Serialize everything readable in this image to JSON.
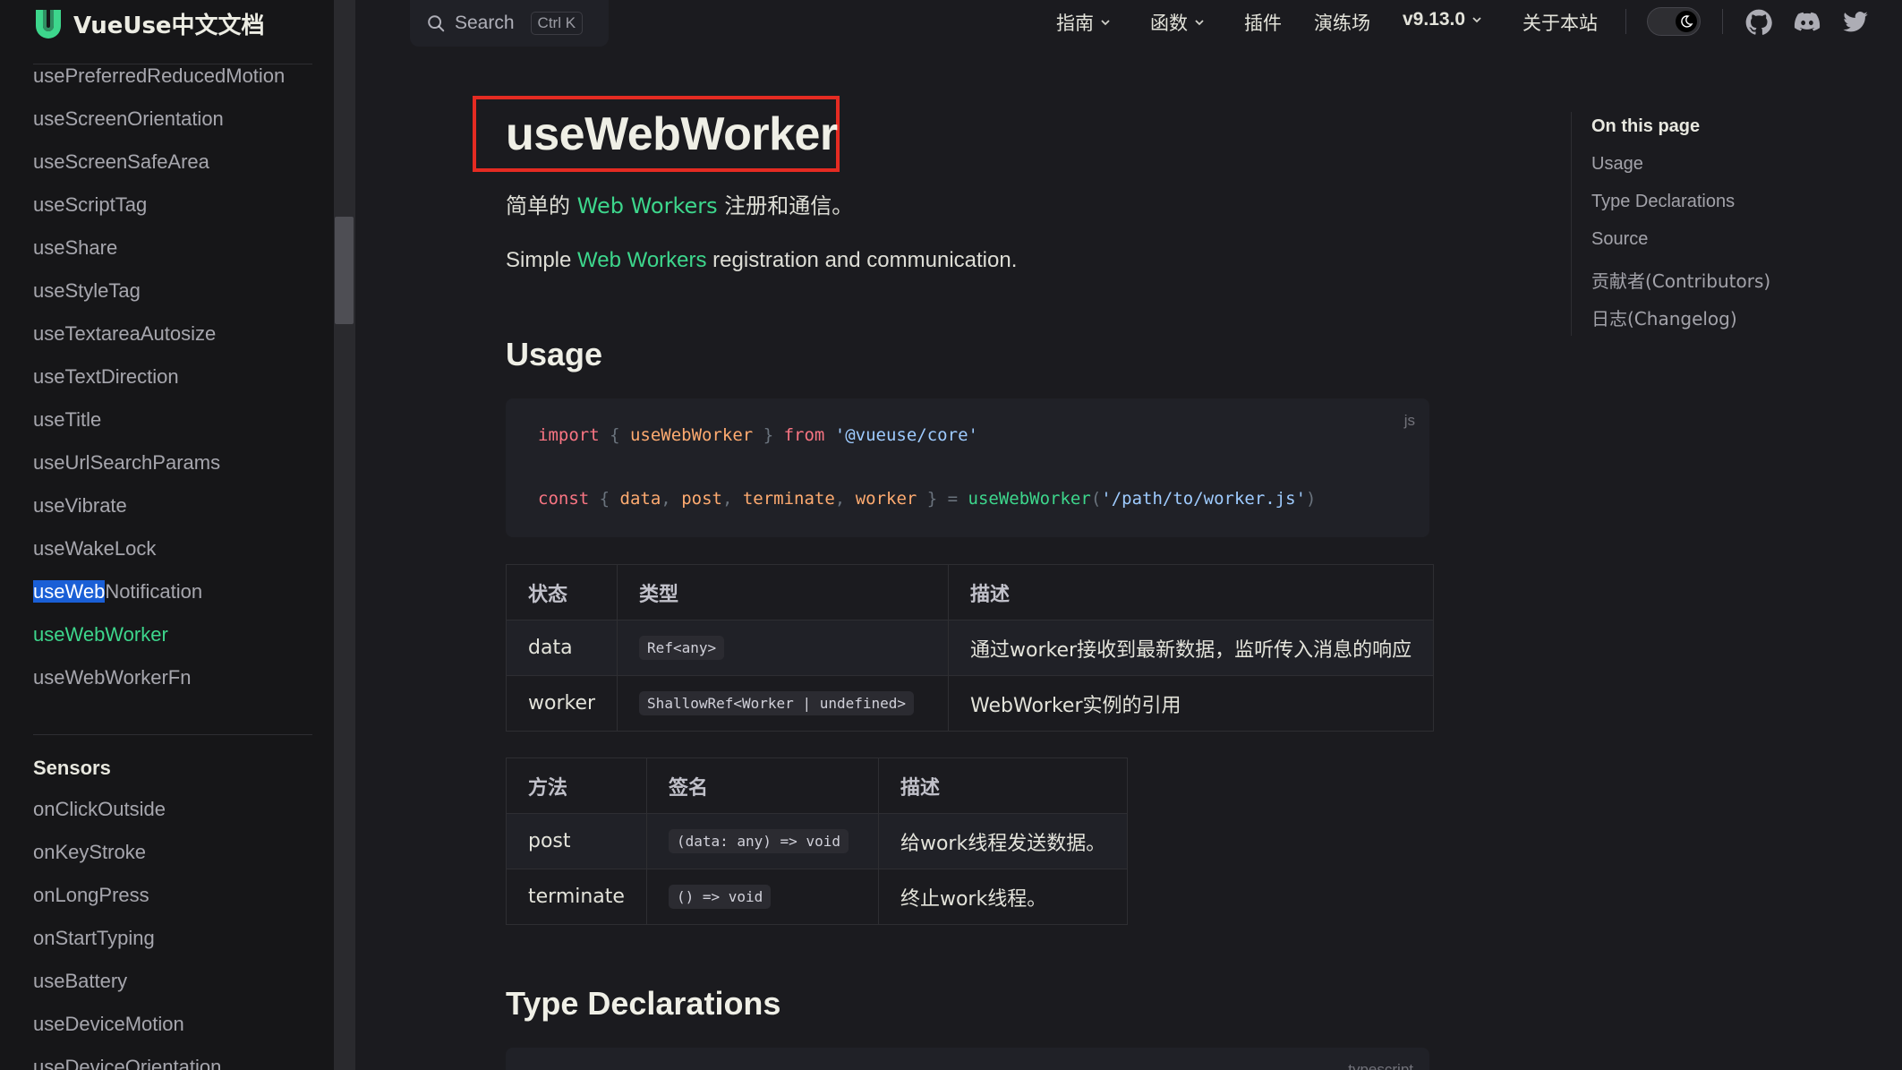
{
  "brand": {
    "name": "VueUse中文文档"
  },
  "search": {
    "label": "Search",
    "shortcut": "Ctrl K"
  },
  "nav": {
    "guide": "指南",
    "functions": "函数",
    "addons": "插件",
    "playground": "演练场",
    "version": "v9.13.0",
    "about": "关于本站"
  },
  "sidebar": {
    "items": [
      "usePreferredReducedMotion",
      "useScreenOrientation",
      "useScreenSafeArea",
      "useScriptTag",
      "useShare",
      "useStyleTag",
      "useTextareaAutosize",
      "useTextDirection",
      "useTitle",
      "useUrlSearchParams",
      "useVibrate",
      "useWakeLock"
    ],
    "highlighted_item": {
      "match": "useWeb",
      "rest": "Notification"
    },
    "active_item": "useWebWorker",
    "after_item": "useWebWorkerFn",
    "group_title": "Sensors",
    "group_items": [
      "onClickOutside",
      "onKeyStroke",
      "onLongPress",
      "onStartTyping",
      "useBattery",
      "useDeviceMotion",
      "useDeviceOrientation"
    ]
  },
  "main": {
    "title": "useWebWorker",
    "desc_zh": {
      "before": "简单的 ",
      "link": "Web Workers",
      "after": " 注册和通信。"
    },
    "desc_en": {
      "before": "Simple ",
      "link": "Web Workers",
      "after": " registration and communication."
    },
    "usage_heading": "Usage",
    "code_lang": "js",
    "type_decl_heading": "Type Declarations",
    "type_decl_lang": "typescript"
  },
  "state_table": {
    "headers": [
      "状态",
      "类型",
      "描述"
    ],
    "rows": [
      [
        "data",
        "Ref<any>",
        "通过worker接收到最新数据，监听传入消息的响应"
      ],
      [
        "worker",
        "ShallowRef<Worker | undefined>",
        "WebWorker实例的引用"
      ]
    ]
  },
  "method_table": {
    "headers": [
      "方法",
      "签名",
      "描述"
    ],
    "rows": [
      [
        "post",
        "(data: any) => void",
        "给work线程发送数据。"
      ],
      [
        "terminate",
        "() => void",
        "终止work线程。"
      ]
    ]
  },
  "aside": {
    "title": "On this page",
    "items": [
      "Usage",
      "Type Declarations",
      "Source",
      "贡献者(Contributors)",
      "日志(Changelog)"
    ]
  }
}
